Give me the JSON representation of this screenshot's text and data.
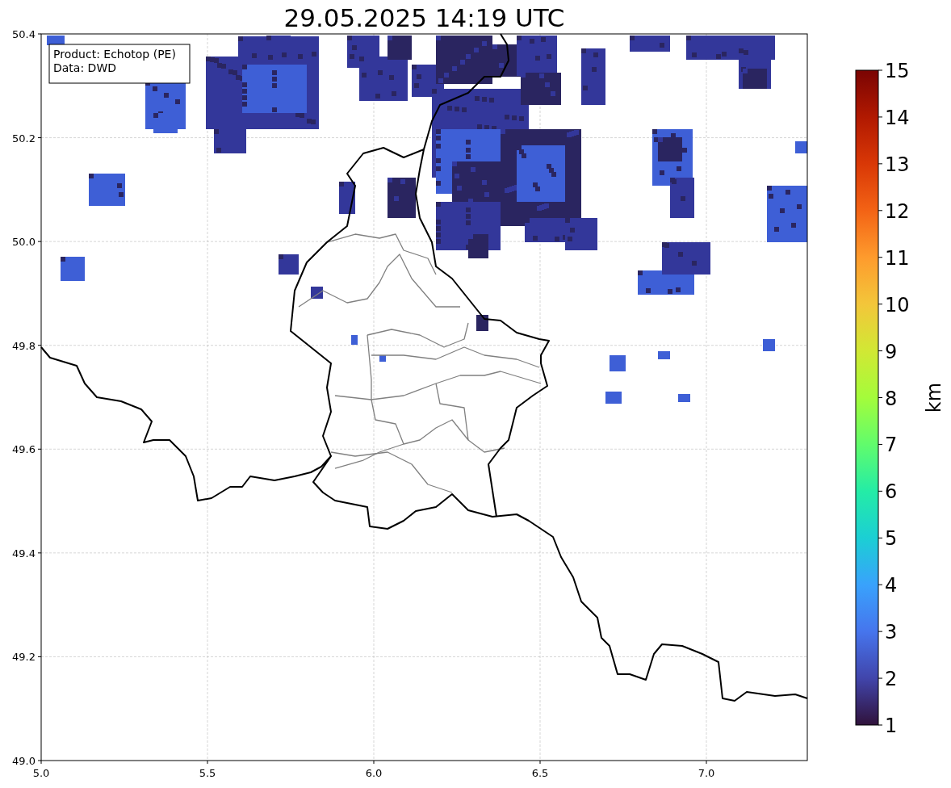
{
  "title": "29.05.2025 14:19 UTC",
  "annotation": [
    "Product: Echotop (PE)",
    "Data: DWD"
  ],
  "x_axis": {
    "ticks": [
      "5.0",
      "5.5",
      "6.0",
      "6.5",
      "7.0"
    ]
  },
  "y_axis": {
    "ticks": [
      "50.4",
      "50.2",
      "50.0",
      "49.8",
      "49.6",
      "49.4",
      "49.2",
      "49.0"
    ]
  },
  "colorbar": {
    "label": "km",
    "ticks": [
      "15",
      "14",
      "13",
      "12",
      "11",
      "10",
      "9",
      "8",
      "7",
      "6",
      "5",
      "4",
      "3",
      "2",
      "1"
    ]
  }
}
